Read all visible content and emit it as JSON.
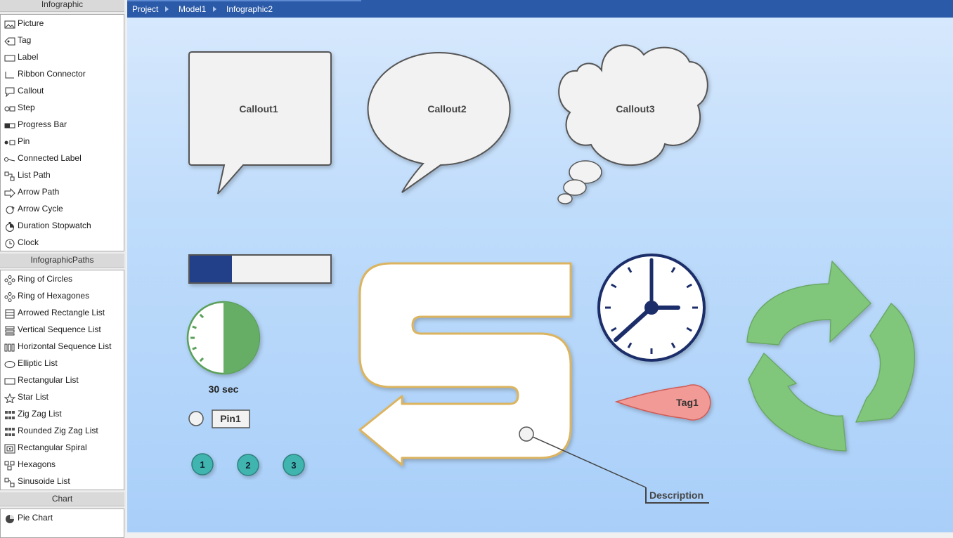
{
  "sidebar": {
    "sections": [
      {
        "title": "Infographic",
        "items": [
          {
            "label": "Picture",
            "icon": "picture-icon"
          },
          {
            "label": "Tag",
            "icon": "tag-icon"
          },
          {
            "label": "Label",
            "icon": "label-icon"
          },
          {
            "label": "Ribbon Connector",
            "icon": "ribbon-connector-icon"
          },
          {
            "label": "Callout",
            "icon": "callout-icon"
          },
          {
            "label": "Step",
            "icon": "step-icon"
          },
          {
            "label": "Progress Bar",
            "icon": "progress-bar-icon"
          },
          {
            "label": "Pin",
            "icon": "pin-icon"
          },
          {
            "label": "Connected Label",
            "icon": "connected-label-icon"
          },
          {
            "label": "List Path",
            "icon": "list-path-icon"
          },
          {
            "label": "Arrow Path",
            "icon": "arrow-path-icon"
          },
          {
            "label": "Arrow Cycle",
            "icon": "arrow-cycle-icon"
          },
          {
            "label": "Duration Stopwatch",
            "icon": "stopwatch-icon"
          },
          {
            "label": "Clock",
            "icon": "clock-icon"
          }
        ]
      },
      {
        "title": "InfographicPaths",
        "items": [
          {
            "label": "Ring of Circles",
            "icon": "ring-of-circles-icon"
          },
          {
            "label": "Ring of Hexagones",
            "icon": "ring-of-hexagones-icon"
          },
          {
            "label": "Arrowed Rectangle List",
            "icon": "arrowed-rectangle-list-icon"
          },
          {
            "label": "Vertical Sequence List",
            "icon": "vertical-sequence-list-icon"
          },
          {
            "label": "Horizontal Sequence List",
            "icon": "horizontal-sequence-list-icon"
          },
          {
            "label": "Elliptic List",
            "icon": "elliptic-list-icon"
          },
          {
            "label": "Rectangular List",
            "icon": "rectangular-list-icon"
          },
          {
            "label": "Star List",
            "icon": "star-list-icon"
          },
          {
            "label": "Zig Zag List",
            "icon": "zig-zag-list-icon"
          },
          {
            "label": "Rounded Zig Zag List",
            "icon": "rounded-zig-zag-list-icon"
          },
          {
            "label": "Rectangular Spiral",
            "icon": "rectangular-spiral-icon"
          },
          {
            "label": "Hexagons",
            "icon": "hexagons-icon"
          },
          {
            "label": "Sinusoide List",
            "icon": "sinusoide-list-icon"
          }
        ]
      },
      {
        "title": "Chart",
        "items": [
          {
            "label": "Pie Chart",
            "icon": "pie-chart-icon"
          }
        ]
      }
    ]
  },
  "breadcrumb": [
    "Project",
    "Model1",
    "Infographic2"
  ],
  "canvas": {
    "callouts": [
      "Callout1",
      "Callout2",
      "Callout3"
    ],
    "progress_bar": {
      "value_fraction": 0.3,
      "fill_color": "#233f8a"
    },
    "stopwatch": {
      "label": "30 sec",
      "elapsed_fraction": 0.5,
      "color": "#66ad66"
    },
    "pin": {
      "label": "Pin1"
    },
    "steps": [
      "1",
      "2",
      "3"
    ],
    "clock": {
      "hours": 7,
      "minutes": 55,
      "face_color": "#1b2e6b"
    },
    "tag": {
      "label": "Tag1",
      "color": "#f29a96"
    },
    "connected_label": {
      "label": "Description"
    },
    "arrow_path_color": "#dcb45e",
    "arrow_cycle_color": "#80c77b"
  }
}
